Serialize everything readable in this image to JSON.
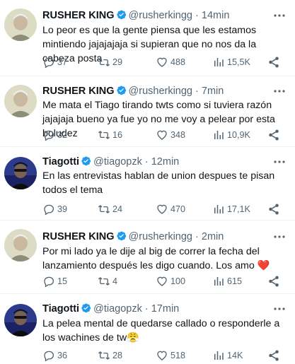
{
  "colors": {
    "verified": "#1d9bf0",
    "text": "#0f1419",
    "secondary": "#536471",
    "heart": "#e0245e"
  },
  "tweets": [
    {
      "name": "RUSHER KING",
      "handle": "@rusherkingg",
      "dot": "·",
      "time": "14min",
      "text": "Lo peor es que la gente piensa que les estamos mintiendo jajajajaja si supieran que no nos da la cabeza posta",
      "replies": "37",
      "retweets": "29",
      "likes": "488",
      "views": "15,5K"
    },
    {
      "name": "RUSHER KING",
      "handle": "@rusherkingg",
      "dot": "·",
      "time": "7min",
      "text": "Me mata el Tiago tirando twts como si tuviera razón jajajaja bueno ya fue yo no me voy a pelear por esta boludez",
      "replies": "32",
      "retweets": "16",
      "likes": "348",
      "views": "10,9K"
    },
    {
      "name": "Tiagotti",
      "handle": "@tiagopzk",
      "dot": "·",
      "time": "12min",
      "text": "En las entrevistas hablan de union despues te pisan todos el tema",
      "replies": "39",
      "retweets": "24",
      "likes": "470",
      "views": "17,1K"
    },
    {
      "name": "RUSHER KING",
      "handle": "@rusherkingg",
      "dot": "·",
      "time": "2min",
      "text": "Por mi lado ya le dije al big de correr la fecha del lanzamiento después les digo cuando. Los amo ❤️",
      "replies": "15",
      "retweets": "4",
      "likes": "100",
      "views": "615"
    },
    {
      "name": "Tiagotti",
      "handle": "@tiagopzk",
      "dot": "·",
      "time": "17min",
      "text": "La pelea mental de quedarse callado o responderle a los wachines de tw😤",
      "replies": "36",
      "retweets": "28",
      "likes": "518",
      "views": "14K"
    }
  ]
}
